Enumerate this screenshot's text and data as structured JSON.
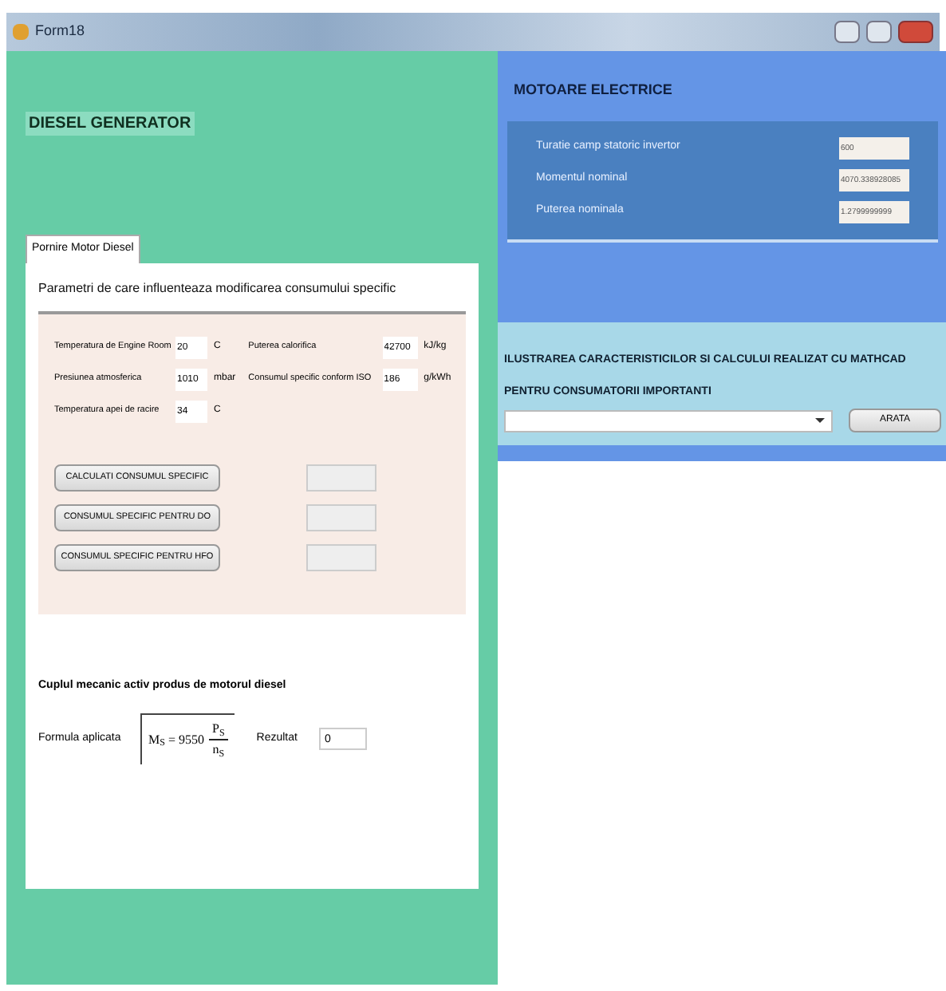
{
  "window": {
    "title": "Form18"
  },
  "diesel": {
    "title": "DIESEL GENERATOR",
    "tabs": [
      {
        "label": "Pornire Motor Diesel",
        "selected": true
      }
    ],
    "section_title": "Parametri de care influenteaza modificarea consumului specific",
    "left_params": [
      {
        "label": "Temperatura de Engine Room",
        "value": "20",
        "unit": "C"
      },
      {
        "label": "Presiunea atmosferica",
        "value": "1010",
        "unit": "mbar"
      },
      {
        "label": "Temperatura apei de racire",
        "value": "34",
        "unit": "C"
      }
    ],
    "right_params": [
      {
        "label": "Puterea calorifica",
        "value": "42700",
        "unit": "kJ/kg"
      },
      {
        "label": "Consumul specific conform ISO",
        "value": "186",
        "unit": "g/kWh"
      }
    ],
    "buttons": [
      "CALCULATI CONSUMUL SPECIFIC",
      "CONSUMUL SPECIFIC PENTRU DO",
      "CONSUMUL SPECIFIC PENTRU HFO"
    ],
    "torque": {
      "title": "Cuplul mecanic activ produs de motorul diesel",
      "formula_label": "Formula aplicata",
      "formula_lhs": "M$_{S}$ = 9550",
      "formula_numerator": "P$_{S}$",
      "formula_denominator": "n$_{S}$",
      "result_label": "Rezultat",
      "result_value": "0"
    }
  },
  "motors": {
    "title": "MOTOARE ELECTRICE",
    "fields": [
      {
        "label": "Turatie camp statoric invertor",
        "value": "600"
      },
      {
        "label": "Momentul nominal",
        "value": "4070.338928085"
      },
      {
        "label": "Puterea nominala",
        "value": "1.2799999999"
      }
    ],
    "illustration_title": "ILUSTRAREA CARACTERISTICILOR SI CALCULUI REALIZAT CU MATHCAD PENTRU CONSUMATORII IMPORTANTI",
    "show_button": "ARATA"
  }
}
